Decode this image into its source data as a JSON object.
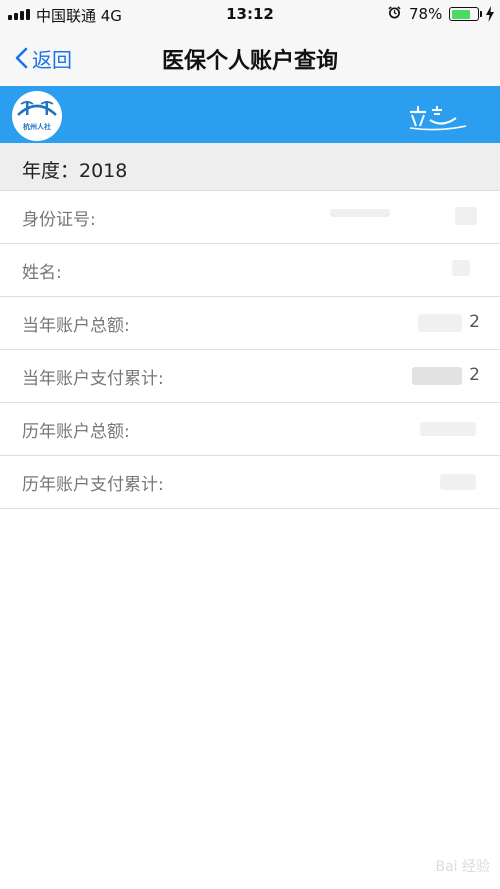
{
  "status_bar": {
    "carrier": "中国联通  4G",
    "time": "13:12",
    "battery_pct": "78%",
    "battery_level": 0.78,
    "battery_color": "#4cd964"
  },
  "nav": {
    "back_label": "返回",
    "title": "医保个人账户查询"
  },
  "banner": {
    "logo_text": "杭州人社",
    "brand_color": "#2b9ef0"
  },
  "year_row": {
    "text": "年度：2018"
  },
  "rows": [
    {
      "label": "身份证号:",
      "value": ""
    },
    {
      "label": "姓名:",
      "value": ""
    },
    {
      "label": "当年账户总额:",
      "value": "2"
    },
    {
      "label": "当年账户支付累计:",
      "value": "2"
    },
    {
      "label": "历年账户总额:",
      "value": ""
    },
    {
      "label": "历年账户支付累计:",
      "value": ""
    }
  ],
  "watermark": "Bai 经验"
}
